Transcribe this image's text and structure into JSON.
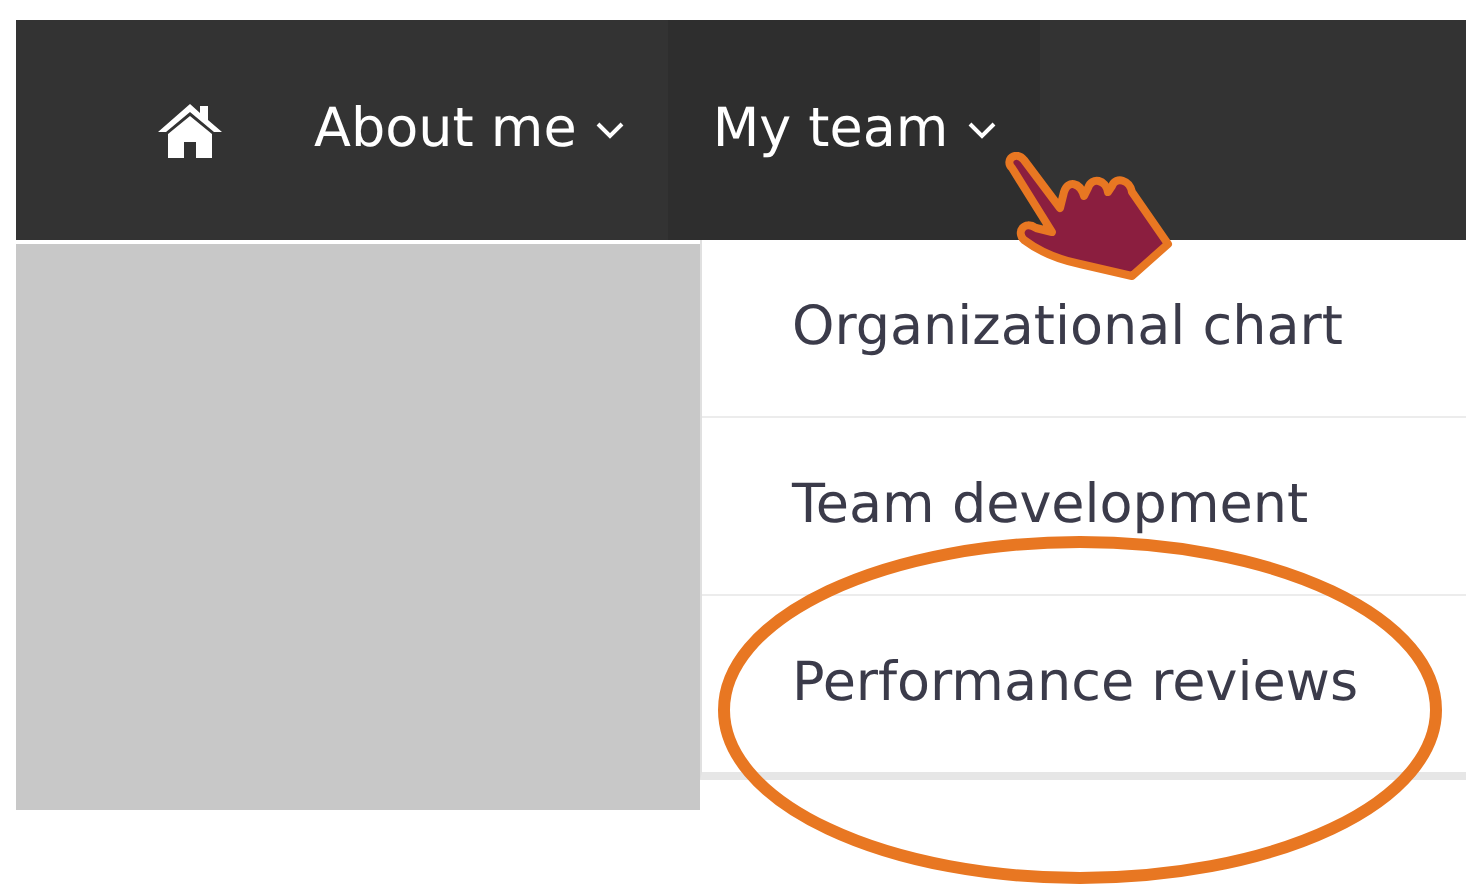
{
  "nav": [
    {
      "kind": "home"
    },
    {
      "kind": "menu",
      "label": "About me",
      "expanded": false
    },
    {
      "kind": "menu",
      "label": "My team",
      "expanded": true
    }
  ],
  "dropdown": [
    {
      "label": "Organizational chart",
      "highlighted": false
    },
    {
      "label": "Team development",
      "highlighted": false
    },
    {
      "label": "Performance reviews",
      "highlighted": true
    }
  ]
}
